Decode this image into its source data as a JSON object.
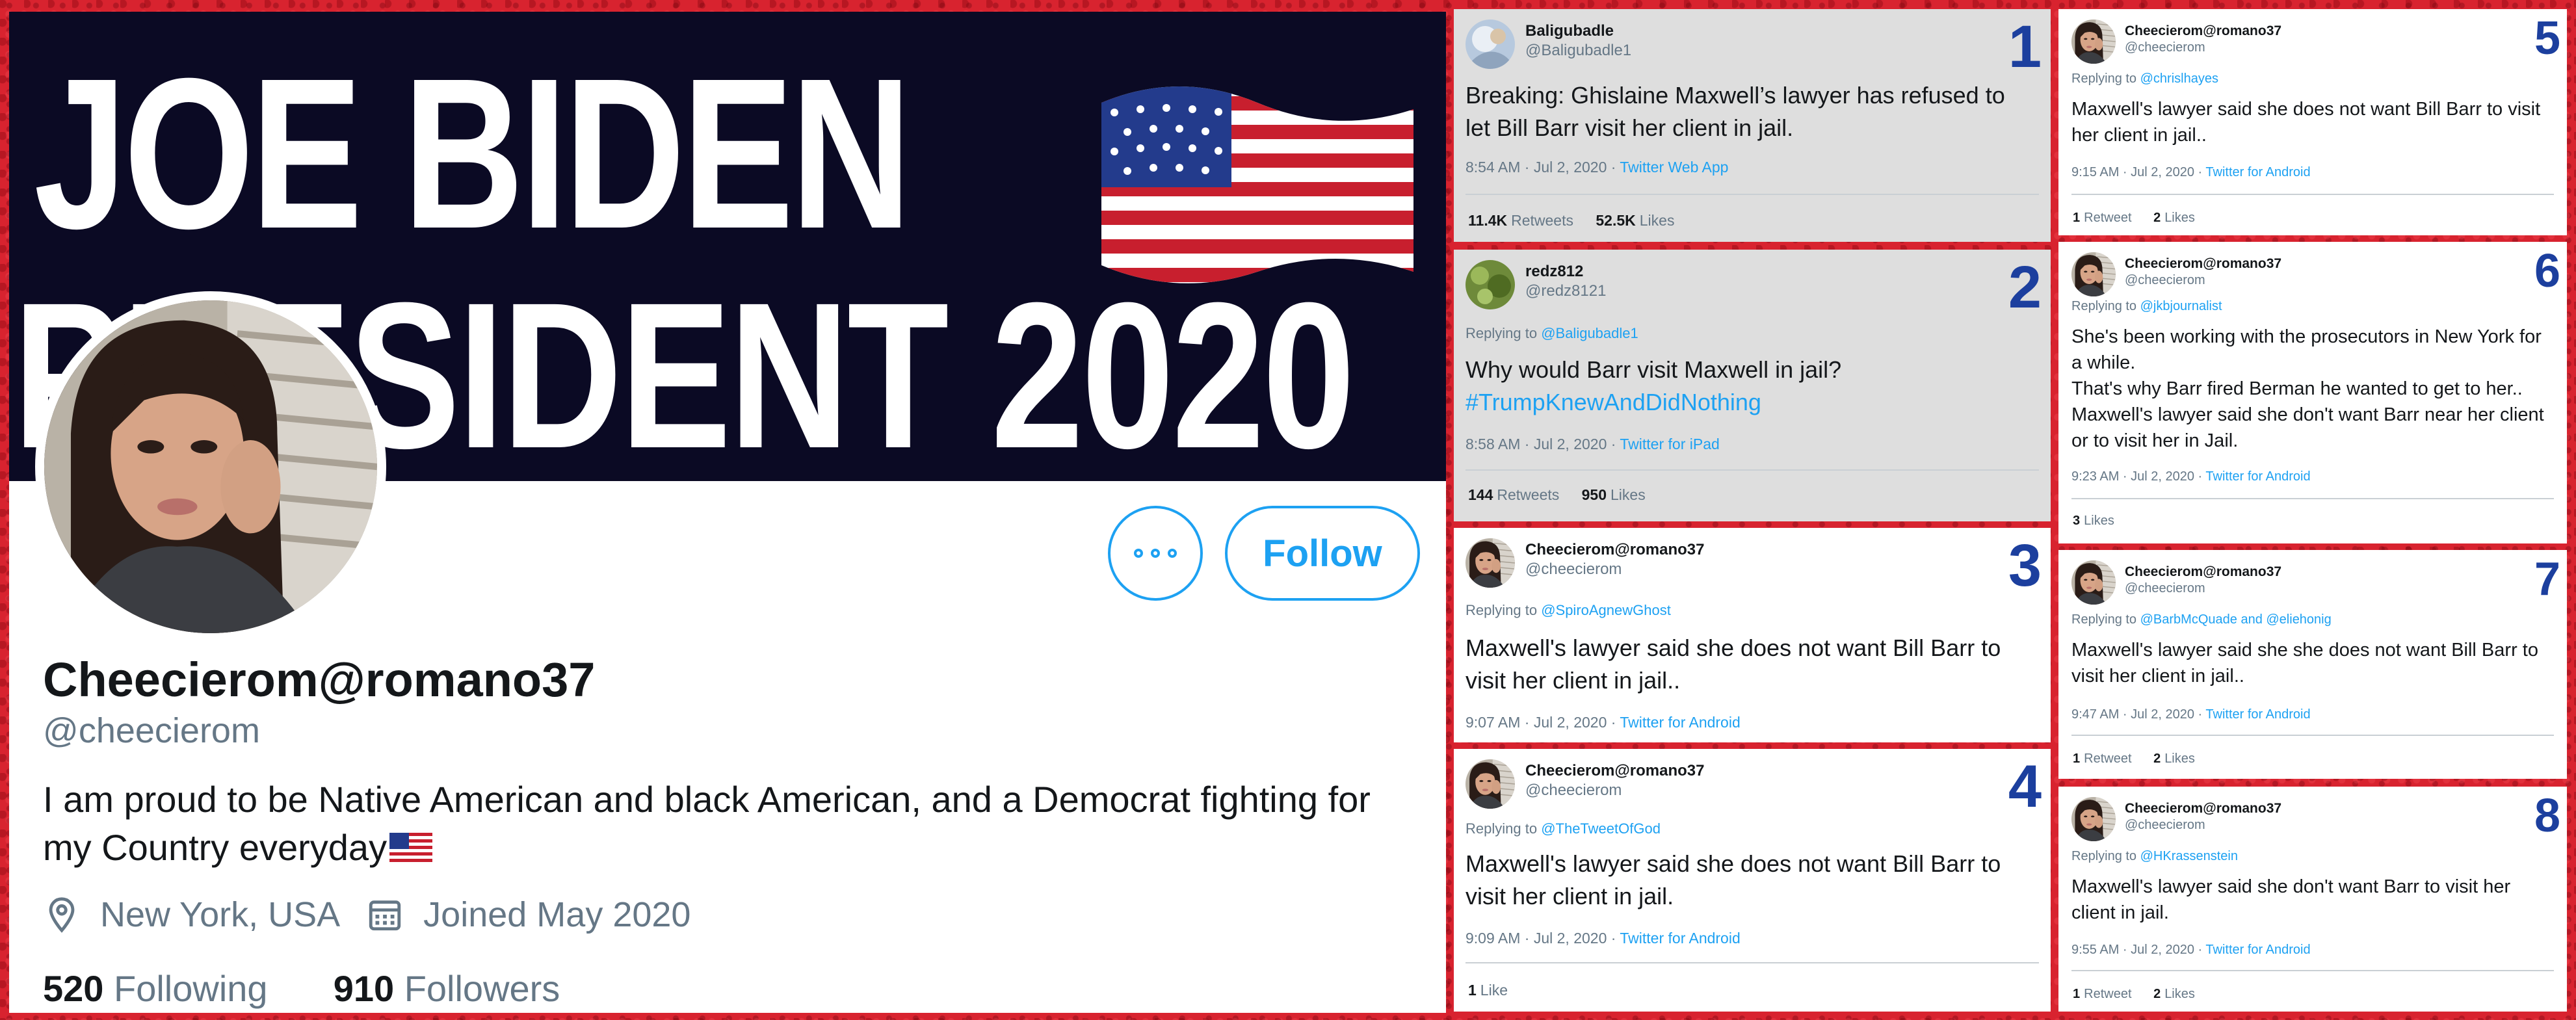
{
  "colors": {
    "accent": "#1da1f2",
    "number_label": "#1c3f9e",
    "frame": "#d8232f",
    "banner_bg": "#0b0a24"
  },
  "profile": {
    "banner_line1": "JOE BIDEN",
    "banner_line2": "PRESIDENT 2020",
    "more_icon": "more-horizontal-icon",
    "follow_label": "Follow",
    "display_name": "Cheecierom@romano37",
    "handle": "@cheecierom",
    "bio": "I am proud to be Native American and black American, and a Democrat fighting for my Country everyday",
    "location_icon": "location-pin-icon",
    "location": "New York, USA",
    "joined_icon": "calendar-icon",
    "joined": "Joined May 2020",
    "following_count": "520",
    "following_label": "Following",
    "followers_count": "910",
    "followers_label": "Followers"
  },
  "tweets": [
    {
      "number": "1",
      "name": "Baligubadle",
      "handle": "@Baligubadle1",
      "text": "Breaking: Ghislaine Maxwell’s lawyer has refused to let Bill Barr visit her client in jail.",
      "time": "8:54 AM · Jul 2, 2020 · ",
      "source": "Twitter Web App",
      "retweets_count": "11.4K",
      "retweets_label": "Retweets",
      "likes_count": "52.5K",
      "likes_label": "Likes"
    },
    {
      "number": "2",
      "name": "redz812",
      "handle": "@redz8121",
      "reply_prefix": "Replying to ",
      "reply_to": "@Baligubadle1",
      "text": "Why would Barr visit Maxwell in jail?",
      "hashtag": "#TrumpKnewAndDidNothing",
      "time": "8:58 AM · Jul 2, 2020 · ",
      "source": "Twitter for iPad",
      "retweets_count": "144",
      "retweets_label": "Retweets",
      "likes_count": "950",
      "likes_label": "Likes"
    },
    {
      "number": "3",
      "name": "Cheecierom@romano37",
      "handle": "@cheecierom",
      "reply_prefix": "Replying to ",
      "reply_to": "@SpiroAgnewGhost",
      "text": "Maxwell's lawyer said she does not want Bill Barr to visit her client in jail..",
      "time": "9:07 AM · Jul 2, 2020 · ",
      "source": "Twitter for Android"
    },
    {
      "number": "4",
      "name": "Cheecierom@romano37",
      "handle": "@cheecierom",
      "reply_prefix": "Replying to ",
      "reply_to": "@TheTweetOfGod",
      "text": "Maxwell's lawyer said she does not want Bill Barr to visit her client in jail.",
      "time": "9:09 AM · Jul 2, 2020 · ",
      "source": "Twitter for Android",
      "likes_count": "1",
      "likes_label": "Like"
    },
    {
      "number": "5",
      "name": "Cheecierom@romano37",
      "handle": "@cheecierom",
      "reply_prefix": "Replying to ",
      "reply_to": "@chrislhayes",
      "text": "Maxwell's lawyer said she does not want Bill Barr to visit her client in jail..",
      "time": "9:15 AM · Jul 2, 2020 · ",
      "source": "Twitter for Android",
      "retweets_count": "1",
      "retweets_label": "Retweet",
      "likes_count": "2",
      "likes_label": "Likes"
    },
    {
      "number": "6",
      "name": "Cheecierom@romano37",
      "handle": "@cheecierom",
      "reply_prefix": "Replying to ",
      "reply_to": "@jkbjournalist",
      "text_line1": "She's been working with the prosecutors in New York for a while.",
      "text_line2": "That's why Barr fired Berman he wanted to get to her..",
      "text_line3": "Maxwell's lawyer said she don't want Barr near her client or to visit her in Jail.",
      "time": "9:23 AM · Jul 2, 2020 · ",
      "source": "Twitter for Android",
      "likes_count": "3",
      "likes_label": "Likes"
    },
    {
      "number": "7",
      "name": "Cheecierom@romano37",
      "handle": "@cheecierom",
      "reply_prefix": "Replying to ",
      "reply_to": "@BarbMcQuade",
      "reply_and": " and ",
      "reply_to2": "@eliehonig",
      "text": "Maxwell's lawyer said she she does not want Bill Barr to visit her client in jail..",
      "time": "9:47 AM · Jul 2, 2020 · ",
      "source": "Twitter for Android",
      "retweets_count": "1",
      "retweets_label": "Retweet",
      "likes_count": "2",
      "likes_label": "Likes"
    },
    {
      "number": "8",
      "name": "Cheecierom@romano37",
      "handle": "@cheecierom",
      "reply_prefix": "Replying to ",
      "reply_to": "@HKrassenstein",
      "text": "Maxwell's lawyer said she don't want Barr to visit her client in jail.",
      "time": "9:55 AM · Jul 2, 2020 · ",
      "source": "Twitter for Android",
      "retweets_count": "1",
      "retweets_label": "Retweet",
      "likes_count": "2",
      "likes_label": "Likes"
    }
  ]
}
